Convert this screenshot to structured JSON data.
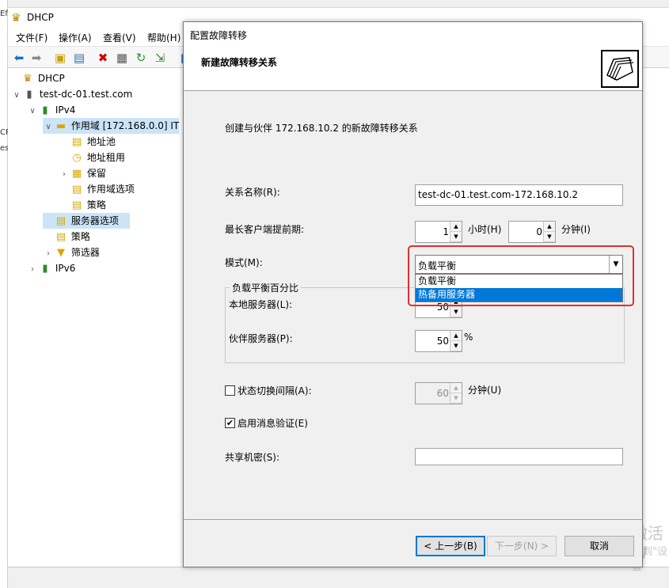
{
  "background_window": {
    "title": "DHCP",
    "menu": [
      "文件(F)",
      "操作(A)",
      "查看(V)",
      "帮助(H)"
    ],
    "tree": [
      {
        "label": "DHCP",
        "icon": "dhcp-icon",
        "level": 0
      },
      {
        "label": "test-dc-01.test.com",
        "icon": "server-icon",
        "level": 1,
        "expanded": true
      },
      {
        "label": "IPv4",
        "icon": "ipv4-icon",
        "level": 2,
        "expanded": true
      },
      {
        "label": "作用域 [172.168.0.0] IT",
        "icon": "folder-icon",
        "level": 3,
        "expanded": true,
        "selected": true
      },
      {
        "label": "地址池",
        "icon": "address-pool-icon",
        "level": 4
      },
      {
        "label": "地址租用",
        "icon": "address-lease-icon",
        "level": 4
      },
      {
        "label": "保留",
        "icon": "reservation-icon",
        "level": 4,
        "collapsed": true
      },
      {
        "label": "作用域选项",
        "icon": "scope-options-icon",
        "level": 4
      },
      {
        "label": "策略",
        "icon": "policy-icon",
        "level": 4
      },
      {
        "label": "服务器选项",
        "icon": "server-options-icon",
        "level": 3
      },
      {
        "label": "策略",
        "icon": "policy-icon",
        "level": 3
      },
      {
        "label": "筛选器",
        "icon": "filter-icon",
        "level": 3,
        "collapsed": true
      },
      {
        "label": "IPv6",
        "icon": "ipv6-icon",
        "level": 2,
        "collapsed": true
      }
    ],
    "left_strip_text": [
      "Ef",
      "CP",
      "es"
    ],
    "watermark": {
      "line1": "激活 W",
      "line2": "转到\"设置"
    }
  },
  "dialog": {
    "title": "配置故障转移",
    "header_title": "新建故障转移关系",
    "description": "创建与伙伴 172.168.10.2 的新故障转移关系",
    "relationship_name_label": "关系名称(R):",
    "relationship_name_value": "test-dc-01.test.com-172.168.10.2",
    "mclt_label": "最长客户端提前期:",
    "mclt_hours_value": "1",
    "mclt_hours_unit": "小时(H)",
    "mclt_minutes_value": "0",
    "mclt_minutes_unit": "分钟(I)",
    "mode_label": "模式(M):",
    "mode_value": "负载平衡",
    "mode_options": [
      "负载平衡",
      "热备用服务器"
    ],
    "mode_highlighted_index": 1,
    "load_balance_group": "负载平衡百分比",
    "local_server_label": "本地服务器(L):",
    "local_server_value": "50",
    "partner_server_label": "伙伴服务器(P):",
    "partner_server_value": "50",
    "percent_sign": "%",
    "switchover_label": "状态切换间隔(A):",
    "switchover_checked": false,
    "switchover_value": "60",
    "switchover_unit": "分钟(U)",
    "auth_label": "启用消息验证(E)",
    "auth_checked": true,
    "shared_secret_label": "共享机密(S):",
    "shared_secret_value": "",
    "buttons": {
      "back": "< 上一步(B)",
      "next": "下一步(N) >",
      "cancel": "取消"
    }
  },
  "colors": {
    "highlight": "#0078d7",
    "annotation_box": "#e03030"
  }
}
